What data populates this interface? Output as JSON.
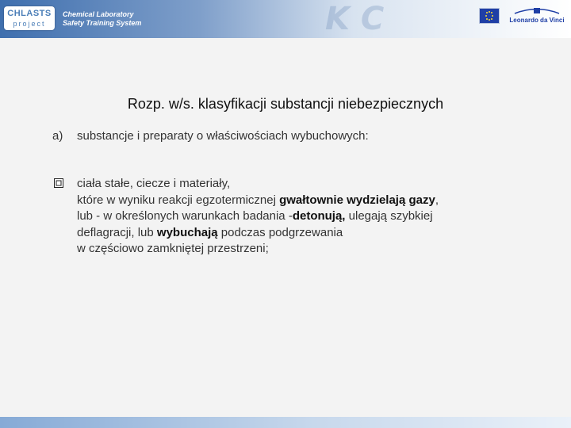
{
  "header": {
    "logo_line1": "CHLASTS",
    "logo_line2": "project",
    "brand_line1": "Chemical Laboratory",
    "brand_line2": "Safety Training System",
    "partner_label": "Leonardo da Vinci",
    "colors": {
      "banner": "#3f6fae",
      "accent": "#1f3fa6"
    }
  },
  "slide": {
    "title": "Rozp. w/s. klasyfikacji substancji niebezpiecznych",
    "item_a": {
      "marker": "a)",
      "text": "substancje i preparaty o właściwościach wybuchowych:"
    },
    "bullet": {
      "icon": "checkbox-bullet-icon",
      "line1": "ciała stałe, ciecze i materiały,",
      "line2_pre": "które w wyniku reakcji egzotermicznej ",
      "line2_bold": "gwałtownie wydzielają gazy",
      "line2_post": ",",
      "line3_pre": "lub - w określonych warunkach badania -",
      "line3_bold": "detonują,",
      "line3_post": " ulegają szybkiej",
      "line4_pre": "deflagracji, lub ",
      "line4_bold": "wybuchają",
      "line4_post": " podczas podgrzewania",
      "line5": "w częściowo zamkniętej przestrzeni;"
    }
  }
}
